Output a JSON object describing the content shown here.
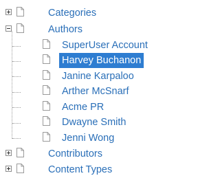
{
  "tree": {
    "nodes": [
      {
        "label": "Categories",
        "expander": "plus"
      },
      {
        "label": "Authors",
        "expander": "minus"
      },
      {
        "label": "SuperUser Account"
      },
      {
        "label": "Harvey Buchanon",
        "selected": true
      },
      {
        "label": "Janine Karpaloo"
      },
      {
        "label": "Arther McSnarf"
      },
      {
        "label": "Acme PR"
      },
      {
        "label": "Dwayne Smith"
      },
      {
        "label": "Jenni Wong"
      },
      {
        "label": "Contributors",
        "expander": "plus"
      },
      {
        "label": "Content Types",
        "expander": "plus"
      }
    ],
    "icons": {
      "expand": "plus-box-icon",
      "collapse": "minus-box-icon",
      "node": "document-icon"
    }
  },
  "colors": {
    "link": "#2a6fb8",
    "selection": "#2e7dd1",
    "selection_text": "#ffffff"
  }
}
